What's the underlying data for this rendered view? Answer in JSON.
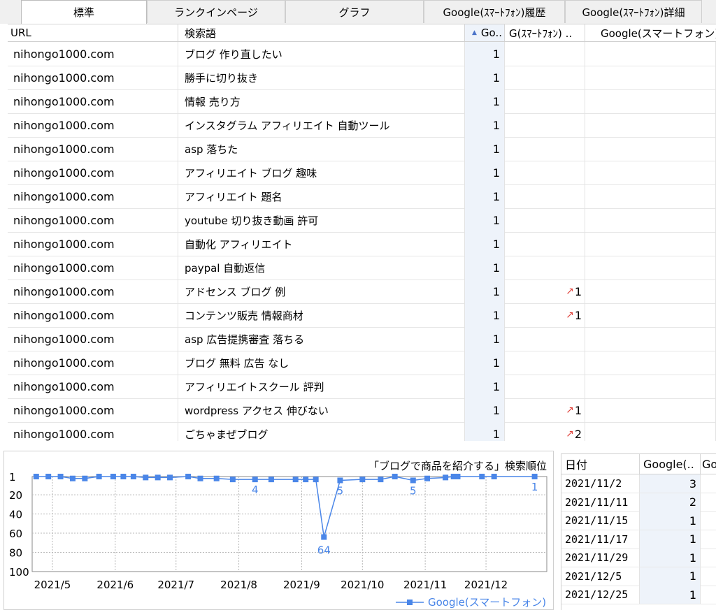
{
  "tabs": [
    {
      "label": "標準",
      "active": true
    },
    {
      "label": "ランクインページ",
      "active": false
    },
    {
      "label": "グラフ",
      "active": false
    },
    {
      "label": "Google(ｽﾏｰﾄﾌｫﾝ)履歴",
      "active": false
    },
    {
      "label": "Google(ｽﾏｰﾄﾌｫﾝ)詳細",
      "active": false
    }
  ],
  "table": {
    "columns": [
      "URL",
      "検索語",
      "Go..",
      "G(ｽﾏｰﾄﾌｫﾝ) ..",
      "Google(スマートフォン)"
    ],
    "sort_indicator": "▲",
    "rows": [
      {
        "url": "nihongo1000.com",
        "keyword": "ブログ 作り直したい",
        "go": "1",
        "trend": "",
        "change": ""
      },
      {
        "url": "nihongo1000.com",
        "keyword": "勝手に切り抜き",
        "go": "1",
        "trend": "",
        "change": ""
      },
      {
        "url": "nihongo1000.com",
        "keyword": "情報 売り方",
        "go": "1",
        "trend": "",
        "change": ""
      },
      {
        "url": "nihongo1000.com",
        "keyword": "インスタグラム アフィリエイト 自動ツール",
        "go": "1",
        "trend": "",
        "change": ""
      },
      {
        "url": "nihongo1000.com",
        "keyword": "asp 落ちた",
        "go": "1",
        "trend": "",
        "change": ""
      },
      {
        "url": "nihongo1000.com",
        "keyword": "アフィリエイト ブログ 趣味",
        "go": "1",
        "trend": "",
        "change": ""
      },
      {
        "url": "nihongo1000.com",
        "keyword": "アフィリエイト 題名",
        "go": "1",
        "trend": "",
        "change": ""
      },
      {
        "url": "nihongo1000.com",
        "keyword": "youtube 切り抜き動画 許可",
        "go": "1",
        "trend": "",
        "change": ""
      },
      {
        "url": "nihongo1000.com",
        "keyword": "自動化 アフィリエイト",
        "go": "1",
        "trend": "",
        "change": ""
      },
      {
        "url": "nihongo1000.com",
        "keyword": "paypal 自動返信",
        "go": "1",
        "trend": "",
        "change": ""
      },
      {
        "url": "nihongo1000.com",
        "keyword": "アドセンス ブログ 例",
        "go": "1",
        "trend": "↗",
        "change": "1"
      },
      {
        "url": "nihongo1000.com",
        "keyword": "コンテンツ販売 情報商材",
        "go": "1",
        "trend": "↗",
        "change": "1"
      },
      {
        "url": "nihongo1000.com",
        "keyword": "asp 広告提携審査 落ちる",
        "go": "1",
        "trend": "",
        "change": ""
      },
      {
        "url": "nihongo1000.com",
        "keyword": "ブログ 無料 広告 なし",
        "go": "1",
        "trend": "",
        "change": ""
      },
      {
        "url": "nihongo1000.com",
        "keyword": "アフィリエイトスクール 評判",
        "go": "1",
        "trend": "",
        "change": ""
      },
      {
        "url": "nihongo1000.com",
        "keyword": "wordpress アクセス 伸びない",
        "go": "1",
        "trend": "↗",
        "change": "1"
      },
      {
        "url": "nihongo1000.com",
        "keyword": "ごちゃまぜブログ",
        "go": "1",
        "trend": "↗",
        "change": "2"
      }
    ]
  },
  "chart_data": {
    "type": "line",
    "title": "「ブログで商品を紹介する」検索順位",
    "legend": "Google(スマートフォン)",
    "legend_position": "bottom-right",
    "color": "#4a86e8",
    "y_reversed": true,
    "ylim": [
      1,
      100
    ],
    "y_ticks": [
      "1",
      "20",
      "40",
      "60",
      "80",
      "100"
    ],
    "x_ticks": [
      "2021/5",
      "2021/6",
      "2021/7",
      "2021/8",
      "2021/9",
      "2021/10",
      "2021/11",
      "2021/12"
    ],
    "x_range": [
      "2021-04-21",
      "2021-12-31"
    ],
    "grid": true,
    "points": [
      {
        "x": "2021-04-23",
        "y": 1
      },
      {
        "x": "2021-04-29",
        "y": 1
      },
      {
        "x": "2021-05-05",
        "y": 1
      },
      {
        "x": "2021-05-11",
        "y": 3
      },
      {
        "x": "2021-05-17",
        "y": 3
      },
      {
        "x": "2021-05-24",
        "y": 1
      },
      {
        "x": "2021-05-31",
        "y": 1
      },
      {
        "x": "2021-06-05",
        "y": 1
      },
      {
        "x": "2021-06-10",
        "y": 1
      },
      {
        "x": "2021-06-16",
        "y": 2
      },
      {
        "x": "2021-06-22",
        "y": 2
      },
      {
        "x": "2021-06-28",
        "y": 2
      },
      {
        "x": "2021-07-07",
        "y": 1
      },
      {
        "x": "2021-07-13",
        "y": 3
      },
      {
        "x": "2021-07-21",
        "y": 3
      },
      {
        "x": "2021-07-29",
        "y": 4
      },
      {
        "x": "2021-08-09",
        "y": 4,
        "label": "4"
      },
      {
        "x": "2021-08-17",
        "y": 4
      },
      {
        "x": "2021-08-29",
        "y": 4
      },
      {
        "x": "2021-09-03",
        "y": 4
      },
      {
        "x": "2021-09-08",
        "y": 4
      },
      {
        "x": "2021-09-12",
        "y": 64,
        "label": "64"
      },
      {
        "x": "2021-09-20",
        "y": 5,
        "label": "5"
      },
      {
        "x": "2021-10-01",
        "y": 4
      },
      {
        "x": "2021-10-10",
        "y": 4
      },
      {
        "x": "2021-10-17",
        "y": 1
      },
      {
        "x": "2021-10-26",
        "y": 5,
        "label": "5"
      },
      {
        "x": "2021-11-02",
        "y": 3
      },
      {
        "x": "2021-11-11",
        "y": 2
      },
      {
        "x": "2021-11-15",
        "y": 1
      },
      {
        "x": "2021-11-17",
        "y": 1
      },
      {
        "x": "2021-11-29",
        "y": 1
      },
      {
        "x": "2021-12-05",
        "y": 1
      },
      {
        "x": "2021-12-25",
        "y": 1,
        "label": "1"
      }
    ]
  },
  "history": {
    "columns": [
      "日付",
      "Google(..",
      "Go"
    ],
    "rows": [
      {
        "date": "2021/11/2",
        "value": "3"
      },
      {
        "date": "2021/11/11",
        "value": "2"
      },
      {
        "date": "2021/11/15",
        "value": "1"
      },
      {
        "date": "2021/11/17",
        "value": "1"
      },
      {
        "date": "2021/11/29",
        "value": "1"
      },
      {
        "date": "2021/12/5",
        "value": "1"
      },
      {
        "date": "2021/12/25",
        "value": "1"
      }
    ]
  }
}
